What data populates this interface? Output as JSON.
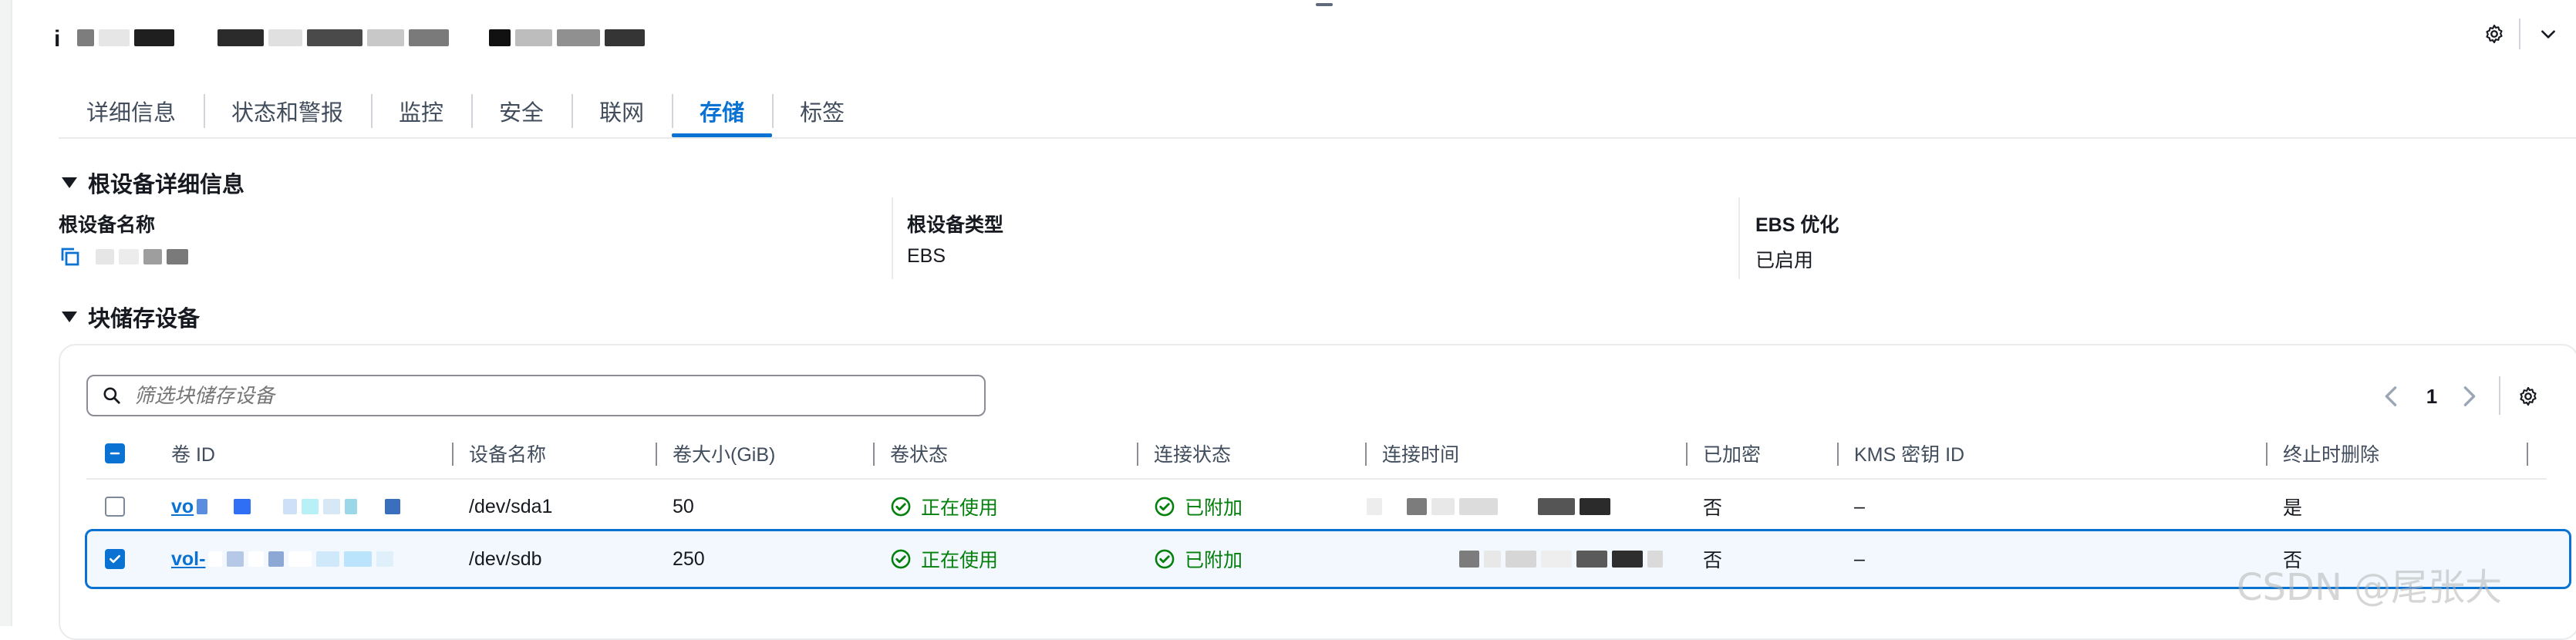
{
  "header": {
    "instance_id_prefix": "i",
    "redacted_blocks": [
      "#7d7d7d",
      "#e6e6e6",
      "#1f1f1f",
      "#e0e0e0",
      "#2b2b2b",
      "#c8c8c8",
      "#4a4a4a",
      "#7a7a7a",
      "#111111",
      "#bdbdbd",
      "#353535",
      "#909090"
    ]
  },
  "tabs": [
    {
      "label": "详细信息",
      "active": false
    },
    {
      "label": "状态和警报",
      "active": false
    },
    {
      "label": "监控",
      "active": false
    },
    {
      "label": "安全",
      "active": false
    },
    {
      "label": "联网",
      "active": false
    },
    {
      "label": "存储",
      "active": true
    },
    {
      "label": "标签",
      "active": false
    }
  ],
  "root_device": {
    "section_title": "根设备详细信息",
    "name_label": "根设备名称",
    "name_value": "",
    "type_label": "根设备类型",
    "type_value": "EBS",
    "ebs_opt_label": "EBS 优化",
    "ebs_opt_value": "已启用"
  },
  "block_devices": {
    "section_title": "块储存设备",
    "filter_placeholder": "筛选块储存设备",
    "page_number": "1",
    "columns": [
      "卷 ID",
      "设备名称",
      "卷大小(GiB)",
      "卷状态",
      "连接状态",
      "连接时间",
      "已加密",
      "KMS 密钥 ID",
      "终止时删除"
    ],
    "rows": [
      {
        "volume_id": "vo",
        "device": "/dev/sda1",
        "size": "50",
        "vol_state": "正在使用",
        "attach_state": "已附加",
        "attach_time": "",
        "encrypted": "否",
        "kms": "–",
        "delete_on_term": "是",
        "selected": false
      },
      {
        "volume_id": "vol-",
        "device": "/dev/sdb",
        "size": "250",
        "vol_state": "正在使用",
        "attach_state": "已附加",
        "attach_time": "",
        "encrypted": "否",
        "kms": "–",
        "delete_on_term": "否",
        "selected": true
      }
    ]
  },
  "watermark": "CSDN @尾张大",
  "colors": {
    "accent": "#0972d3",
    "success": "#037f0c",
    "text": "#16191f",
    "muted": "#414d5c"
  },
  "icons": [
    "copy-icon",
    "search-icon",
    "gear-icon",
    "chevron-down-icon",
    "chevron-left-icon",
    "chevron-right-icon",
    "success-circle-icon",
    "caret-down-icon"
  ]
}
